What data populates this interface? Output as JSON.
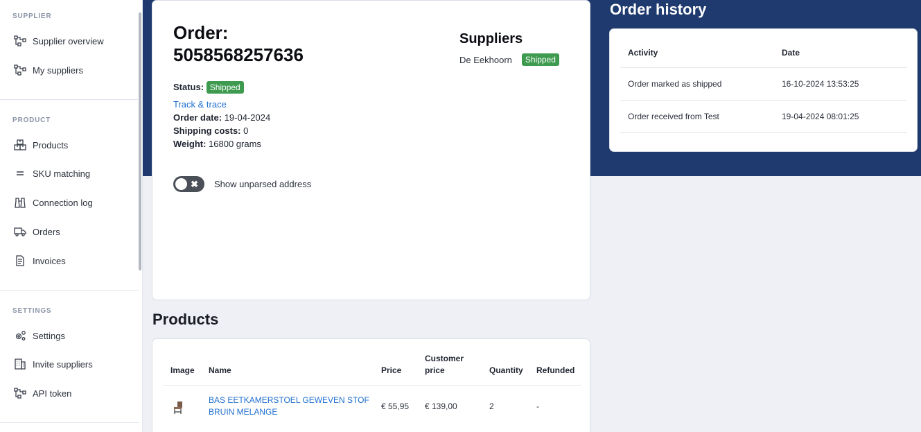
{
  "sidebar": {
    "sections": [
      {
        "heading": "SUPPLIER",
        "items": [
          {
            "label": "Supplier overview",
            "icon": "share-nodes-icon"
          },
          {
            "label": "My suppliers",
            "icon": "share-nodes-icon"
          }
        ]
      },
      {
        "heading": "PRODUCT",
        "items": [
          {
            "label": "Products",
            "icon": "boxes-icon"
          },
          {
            "label": "SKU matching",
            "icon": "equals-icon"
          },
          {
            "label": "Connection log",
            "icon": "binoculars-icon"
          },
          {
            "label": "Orders",
            "icon": "truck-icon"
          },
          {
            "label": "Invoices",
            "icon": "file-invoice-icon"
          }
        ]
      },
      {
        "heading": "SETTINGS",
        "items": [
          {
            "label": "Settings",
            "icon": "gears-icon"
          },
          {
            "label": "Invite suppliers",
            "icon": "building-icon"
          },
          {
            "label": "API token",
            "icon": "share-nodes-icon"
          }
        ]
      }
    ]
  },
  "order": {
    "title_line1": "Order:",
    "title_line2": "5058568257636",
    "status_label": "Status:",
    "status": "Shipped",
    "track_link": "Track & trace",
    "order_date_label": "Order date:",
    "order_date": "19-04-2024",
    "shipping_label": "Shipping costs:",
    "shipping": "0",
    "weight_label": "Weight:",
    "weight": "16800 grams",
    "toggle_label": "Show unparsed address",
    "toggle_on": false
  },
  "suppliers": {
    "title": "Suppliers",
    "name": "De Eekhoorn",
    "status": "Shipped"
  },
  "history": {
    "title": "Order history",
    "columns": [
      "Activity",
      "Date"
    ],
    "rows": [
      [
        "Order marked as shipped",
        "16-10-2024 13:53:25"
      ],
      [
        "Order received from Test",
        "19-04-2024 08:01:25"
      ]
    ]
  },
  "products": {
    "title": "Products",
    "columns": [
      "Image",
      "Name",
      "Price",
      "Customer price",
      "Quantity",
      "Refunded"
    ],
    "rows": [
      {
        "name": "BAS EETKAMERSTOEL GEWEVEN STOF BRUIN MELANGE",
        "price": "€ 55,95",
        "customer_price": "€ 139,00",
        "quantity": "2",
        "refunded": "-"
      }
    ]
  },
  "colors": {
    "hero": "#1f3a6e",
    "badge": "#3d9a4f",
    "link": "#1f6fd1"
  }
}
